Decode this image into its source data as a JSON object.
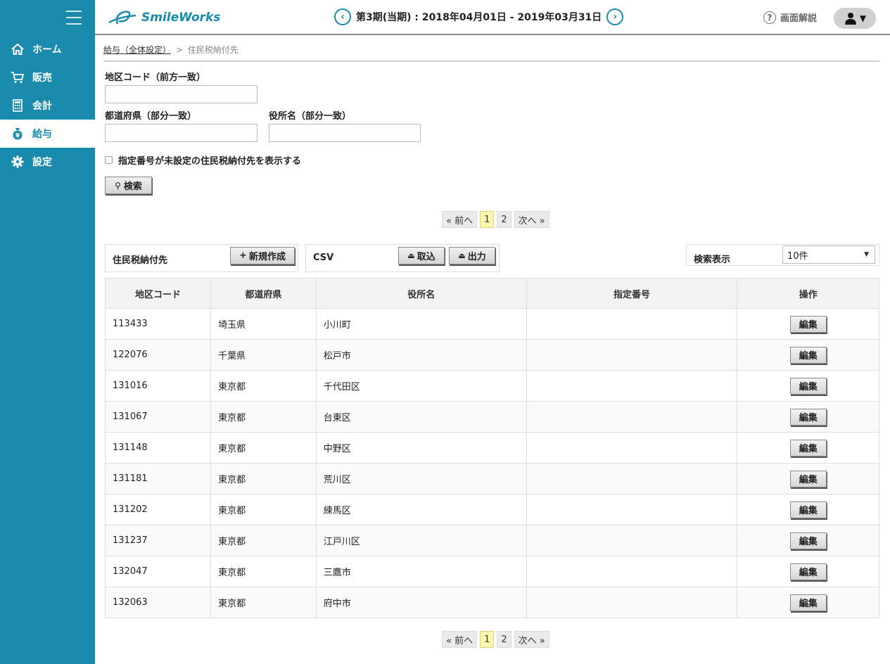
{
  "app": {
    "logo": "SmileWorks",
    "period": "第3期(当期) : 2018年04月01日 - 2019年03月31日",
    "help": "画面解説"
  },
  "sidebar": {
    "items": [
      {
        "label": "ホーム",
        "icon": "home-icon"
      },
      {
        "label": "販売",
        "icon": "cart-icon"
      },
      {
        "label": "会計",
        "icon": "calculator-icon"
      },
      {
        "label": "給与",
        "icon": "money-bag-icon"
      },
      {
        "label": "設定",
        "icon": "gear-icon"
      }
    ]
  },
  "breadcrumb": {
    "parent": "給与（全体設定）",
    "separator": ">",
    "current": "住民税納付先"
  },
  "search": {
    "area_code_label": "地区コード（前方一致）",
    "area_code_value": "",
    "prefecture_label": "都道府県（部分一致）",
    "prefecture_value": "",
    "office_label": "役所名（部分一致）",
    "office_value": "",
    "unset_checkbox_label": "指定番号が未設定の住民税納付先を表示する",
    "search_button": "検索"
  },
  "pager": {
    "prev": "« 前へ",
    "pages": [
      "1",
      "2"
    ],
    "current": "1",
    "next": "次へ »"
  },
  "toolbar": {
    "section_label": "住民税納付先",
    "new_button": "新規作成",
    "csv_label": "CSV",
    "import_button": "取込",
    "export_button": "出力",
    "display_label": "検索表示",
    "display_value": "10件"
  },
  "table": {
    "headers": [
      "地区コード",
      "都道府県",
      "役所名",
      "指定番号",
      "操作"
    ],
    "edit_label": "編集",
    "rows": [
      {
        "code": "113433",
        "pref": "埼玉県",
        "office": "小川町",
        "number": ""
      },
      {
        "code": "122076",
        "pref": "千葉県",
        "office": "松戸市",
        "number": ""
      },
      {
        "code": "131016",
        "pref": "東京都",
        "office": "千代田区",
        "number": ""
      },
      {
        "code": "131067",
        "pref": "東京都",
        "office": "台東区",
        "number": ""
      },
      {
        "code": "131148",
        "pref": "東京都",
        "office": "中野区",
        "number": ""
      },
      {
        "code": "131181",
        "pref": "東京都",
        "office": "荒川区",
        "number": ""
      },
      {
        "code": "131202",
        "pref": "東京都",
        "office": "練馬区",
        "number": ""
      },
      {
        "code": "131237",
        "pref": "東京都",
        "office": "江戸川区",
        "number": ""
      },
      {
        "code": "132047",
        "pref": "東京都",
        "office": "三鷹市",
        "number": ""
      },
      {
        "code": "132063",
        "pref": "東京都",
        "office": "府中市",
        "number": ""
      }
    ]
  },
  "colors": {
    "brand": "#1a8bac",
    "page_highlight": "#fff5b0"
  }
}
